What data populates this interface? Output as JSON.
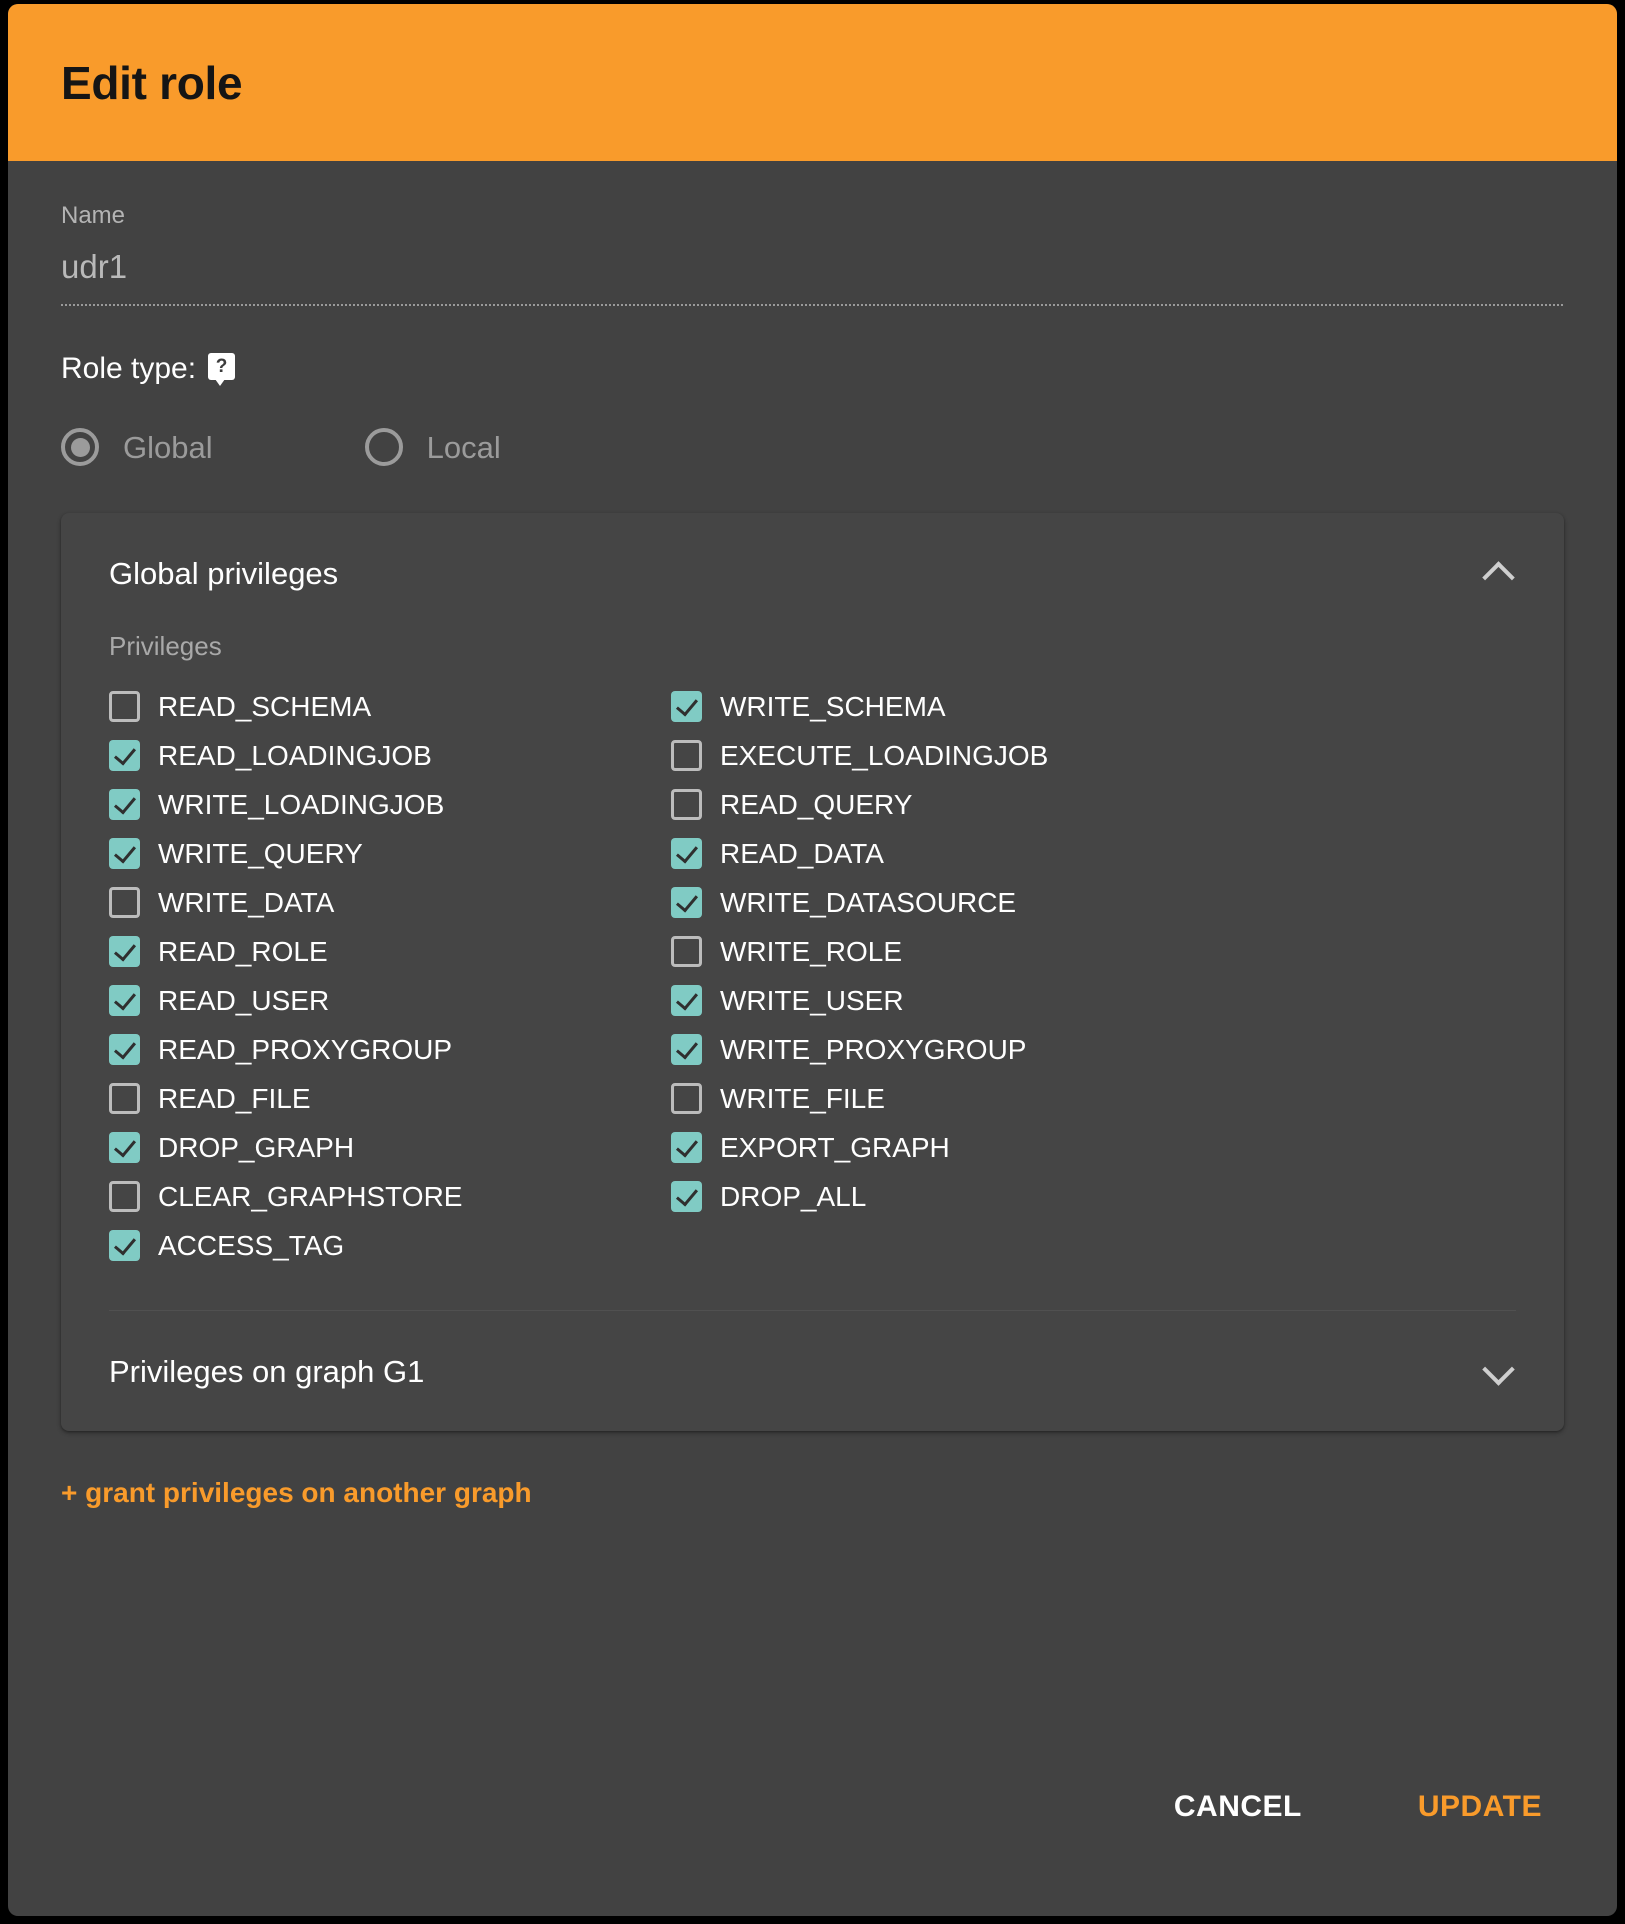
{
  "dialog": {
    "title": "Edit role",
    "accent_color": "#f99b2b",
    "background_color": "#424242",
    "checkbox_checked_color": "#80cbc4"
  },
  "name_field": {
    "label": "Name",
    "value": "udr1"
  },
  "role_type": {
    "label": "Role type:",
    "help_icon": "help-icon",
    "options": [
      {
        "label": "Global",
        "selected": true
      },
      {
        "label": "Local",
        "selected": false
      }
    ]
  },
  "global_panel": {
    "title": "Global privileges",
    "expanded": true,
    "chevron": "chevron-up-icon",
    "privileges_label": "Privileges",
    "privileges": [
      {
        "label": "READ_SCHEMA",
        "checked": false
      },
      {
        "label": "WRITE_SCHEMA",
        "checked": true
      },
      {
        "label": "READ_LOADINGJOB",
        "checked": true
      },
      {
        "label": "EXECUTE_LOADINGJOB",
        "checked": false
      },
      {
        "label": "WRITE_LOADINGJOB",
        "checked": true
      },
      {
        "label": "READ_QUERY",
        "checked": false
      },
      {
        "label": "WRITE_QUERY",
        "checked": true
      },
      {
        "label": "READ_DATA",
        "checked": true
      },
      {
        "label": "WRITE_DATA",
        "checked": false
      },
      {
        "label": "WRITE_DATASOURCE",
        "checked": true
      },
      {
        "label": "READ_ROLE",
        "checked": true
      },
      {
        "label": "WRITE_ROLE",
        "checked": false
      },
      {
        "label": "READ_USER",
        "checked": true
      },
      {
        "label": "WRITE_USER",
        "checked": true
      },
      {
        "label": "READ_PROXYGROUP",
        "checked": true
      },
      {
        "label": "WRITE_PROXYGROUP",
        "checked": true
      },
      {
        "label": "READ_FILE",
        "checked": false
      },
      {
        "label": "WRITE_FILE",
        "checked": false
      },
      {
        "label": "DROP_GRAPH",
        "checked": true
      },
      {
        "label": "EXPORT_GRAPH",
        "checked": true
      },
      {
        "label": "CLEAR_GRAPHSTORE",
        "checked": false
      },
      {
        "label": "DROP_ALL",
        "checked": true
      },
      {
        "label": "ACCESS_TAG",
        "checked": true
      }
    ]
  },
  "graph_panel": {
    "title": "Privileges on graph G1",
    "expanded": false,
    "chevron": "chevron-down-icon"
  },
  "grant_link": {
    "label": "+ grant privileges on another graph"
  },
  "actions": {
    "cancel_label": "CANCEL",
    "update_label": "UPDATE"
  }
}
